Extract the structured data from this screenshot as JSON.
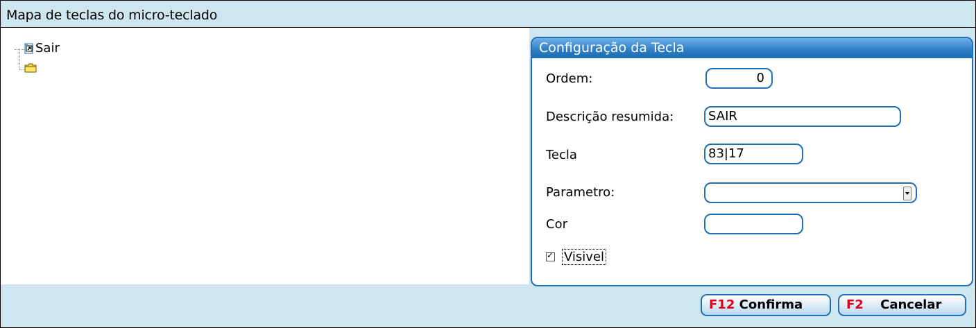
{
  "window": {
    "title": "Mapa de teclas do micro-teclado"
  },
  "tree": {
    "items": [
      {
        "label": "Sair",
        "icon": "shortcut-icon"
      },
      {
        "label": "",
        "icon": "folder-icon"
      }
    ]
  },
  "config": {
    "header": "Configuração da Tecla",
    "ordem_label": "Ordem:",
    "ordem_value": "0",
    "descricao_label": "Descrição resumida:",
    "descricao_value": "SAIR",
    "tecla_label": "Tecla",
    "tecla_value": "83|17",
    "parametro_label": "Parametro:",
    "parametro_value": "",
    "cor_label": "Cor",
    "cor_value": "",
    "visivel_label": "Visivel",
    "visivel_checked": true
  },
  "footer": {
    "confirm_key": "F12",
    "confirm_label": "Confirma",
    "cancel_key": "F2",
    "cancel_label": "Cancelar"
  },
  "colors": {
    "accent": "#1e6fb6",
    "background": "#cfe6f0",
    "hotkey": "#e0001b"
  }
}
